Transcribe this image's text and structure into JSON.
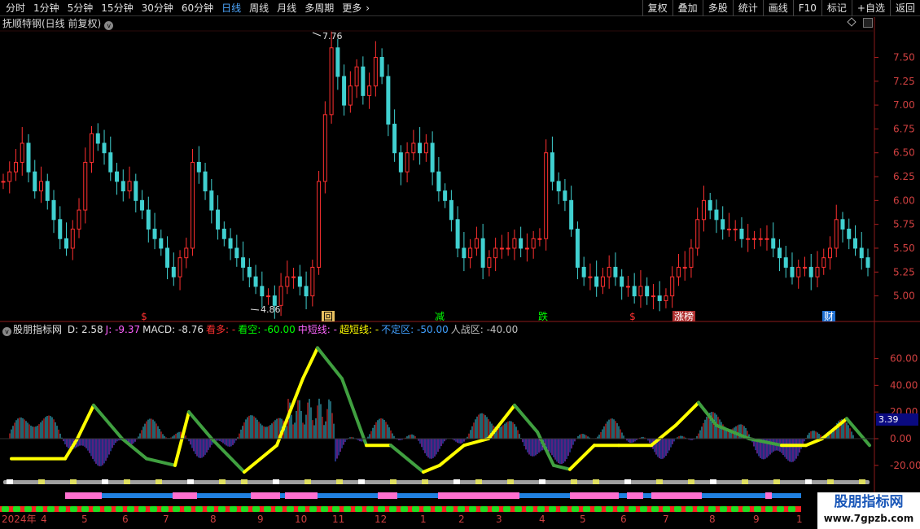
{
  "toolbar": {
    "periods": [
      {
        "label": "分时"
      },
      {
        "label": "1分钟"
      },
      {
        "label": "5分钟"
      },
      {
        "label": "15分钟"
      },
      {
        "label": "30分钟"
      },
      {
        "label": "60分钟"
      },
      {
        "label": "日线",
        "active": true
      },
      {
        "label": "周线"
      },
      {
        "label": "月线"
      },
      {
        "label": "多周期"
      },
      {
        "label": "更多"
      }
    ],
    "more_arrow": "›",
    "tools": [
      {
        "label": "复权"
      },
      {
        "label": "叠加"
      },
      {
        "label": "多股"
      },
      {
        "label": "统计"
      },
      {
        "label": "画线"
      },
      {
        "label": "F10"
      },
      {
        "label": "标记"
      },
      {
        "label": "+自选"
      },
      {
        "label": "返回"
      }
    ]
  },
  "stock": {
    "title": "抚顺特钢(日线 前复权)",
    "dropdown_glyph": "v"
  },
  "price_chart": {
    "high_label": "7.76",
    "low_label": "4.86",
    "y_ticks": [
      "7.50",
      "7.25",
      "7.00",
      "6.75",
      "6.50",
      "6.25",
      "6.00",
      "5.75",
      "5.50",
      "5.25",
      "5.00"
    ],
    "event_markers": [
      {
        "text": "$",
        "color": "#ff3030",
        "bg": "none"
      },
      {
        "text": "回",
        "color": "#000000",
        "bg": "#e8c060"
      },
      {
        "text": "减",
        "color": "#00ff00",
        "bg": "none"
      },
      {
        "text": "跌",
        "color": "#00ff00",
        "bg": "none"
      },
      {
        "text": "$",
        "color": "#ff3030",
        "bg": "none"
      },
      {
        "text": "涨榜",
        "color": "#ffffff",
        "bg": "#b03030"
      },
      {
        "text": "财",
        "color": "#ffffff",
        "bg": "#2070d0"
      }
    ]
  },
  "indicator": {
    "name": "股朋指标网",
    "dropdown_glyph": "v",
    "legend": [
      {
        "text": "D: 2.58",
        "color": "#e0e0e0"
      },
      {
        "text": "J: -9.37",
        "color": "#ff60ff"
      },
      {
        "text": "MACD: -8.76",
        "color": "#e0e0e0"
      },
      {
        "text": "看多: -",
        "color": "#ff3030"
      },
      {
        "text": "看空: -60.00",
        "color": "#00ff00"
      },
      {
        "text": "中短线: -",
        "color": "#ff66ff"
      },
      {
        "text": "超短线: -",
        "color": "#ffff00"
      },
      {
        "text": "不定区: -50.00",
        "color": "#40a0ff"
      },
      {
        "text": "人战区: -40.00",
        "color": "#c0c0c0"
      }
    ],
    "y_ticks": [
      "60.00",
      "40.00",
      "20.00",
      "0.00",
      "-20.00"
    ],
    "current_value": "3.39"
  },
  "date_axis": {
    "labels": [
      "2024年",
      "4",
      "5",
      "6",
      "7",
      "8",
      "9",
      "10",
      "11",
      "12",
      "1",
      "2",
      "3",
      "4",
      "5",
      "6",
      "7",
      "8",
      "9",
      "1"
    ]
  },
  "watermark": {
    "line1": "股朋指标网",
    "line2": "www.7gpzb.com"
  },
  "colors": {
    "up": "#ff3030",
    "down": "#40d0d0",
    "fast_line_yellow": "#ffff00",
    "slow_line_green": "#40a040",
    "axis_text": "#d04040"
  },
  "chart_data": {
    "type": "candlestick",
    "ohlc_close_series": [
      6.2,
      6.3,
      6.4,
      6.6,
      6.3,
      6.1,
      6.2,
      6.0,
      5.8,
      5.6,
      5.5,
      5.7,
      5.9,
      6.4,
      6.7,
      6.6,
      6.5,
      6.3,
      6.2,
      6.1,
      6.2,
      6.0,
      5.9,
      5.7,
      5.6,
      5.5,
      5.3,
      5.2,
      5.4,
      5.5,
      6.4,
      6.3,
      6.1,
      5.9,
      5.7,
      5.6,
      5.5,
      5.4,
      5.3,
      5.2,
      5.1,
      5.0,
      5.0,
      4.9,
      5.1,
      5.2,
      5.2,
      5.1,
      5.0,
      5.3,
      6.2,
      6.9,
      7.6,
      7.3,
      7.0,
      7.2,
      7.4,
      7.1,
      7.2,
      7.5,
      7.3,
      6.8,
      6.5,
      6.3,
      6.5,
      6.6,
      6.5,
      6.6,
      6.3,
      6.1,
      6.0,
      5.8,
      5.5,
      5.4,
      5.5,
      5.6,
      5.3,
      5.4,
      5.5,
      5.5,
      5.5,
      5.6,
      5.5,
      5.5,
      5.6,
      5.6,
      6.5,
      6.2,
      6.1,
      6.0,
      5.7,
      5.3,
      5.2,
      5.2,
      5.1,
      5.2,
      5.3,
      5.2,
      5.1,
      5.1,
      5.0,
      5.1,
      5.0,
      5.0,
      4.95,
      5.0,
      5.2,
      5.3,
      5.3,
      5.5,
      5.8,
      6.0,
      5.9,
      5.8,
      5.7,
      5.7,
      5.7,
      5.6,
      5.6,
      5.6,
      5.6,
      5.6,
      5.5,
      5.4,
      5.3,
      5.2,
      5.3,
      5.3,
      5.2,
      5.3,
      5.4,
      5.5,
      5.8,
      5.7,
      5.6,
      5.5,
      5.4,
      5.3
    ],
    "y_range": [
      4.86,
      7.76
    ],
    "macd_range": [
      -25,
      75
    ]
  }
}
